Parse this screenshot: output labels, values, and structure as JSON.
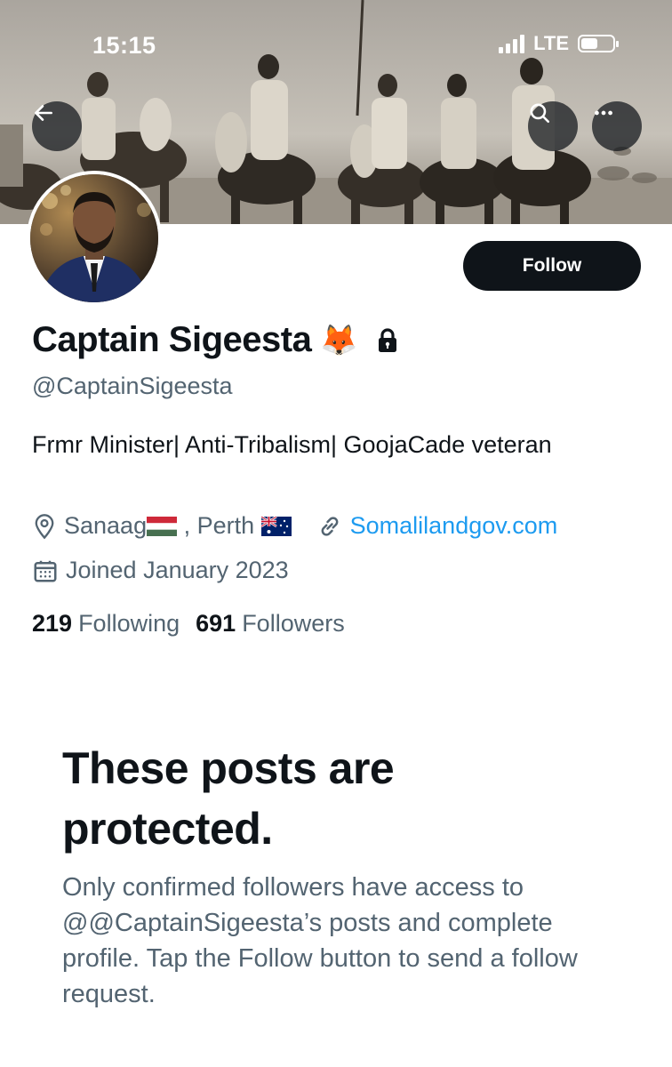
{
  "status_bar": {
    "time": "15:15",
    "network": "LTE"
  },
  "header": {
    "back_icon": "arrow-left-icon",
    "search_icon": "search-icon",
    "more_icon": "more-horizontal-icon"
  },
  "profile": {
    "name": "Captain Sigeesta",
    "name_emoji": "🦊",
    "handle": "@CaptainSigeesta",
    "bio": "Frmr Minister| Anti-Tribalism| GoojaCade veteran",
    "location_part1": "Sanaag",
    "location_part2": " , Perth ",
    "website": "Somalilandgov.com",
    "joined": "Joined January 2023",
    "following_count": "219",
    "following_label": "Following",
    "followers_count": "691",
    "followers_label": "Followers"
  },
  "actions": {
    "follow_label": "Follow"
  },
  "protected": {
    "title": "These posts are protected.",
    "description": "Only confirmed followers have access to @@CaptainSigeesta’s posts and complete profile. Tap the Follow button to send a follow request."
  },
  "colors": {
    "accent": "#1d9bf0",
    "text": "#0f1419",
    "muted": "#536471",
    "button": "#0f1419"
  }
}
